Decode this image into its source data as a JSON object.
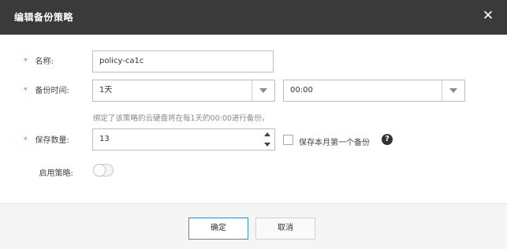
{
  "dialog": {
    "title": "编辑备份策略",
    "close_glyph": "✕"
  },
  "form": {
    "required_mark": "*",
    "name": {
      "label": "名称:",
      "value": "policy-ca1c"
    },
    "backup_time": {
      "label": "备份时间:",
      "frequency_value": "1天",
      "time_value": "00:00",
      "hint": "绑定了该策略的云硬盘将在每1天的00:00进行备份。"
    },
    "retention": {
      "label": "保存数量:",
      "value": "13",
      "keep_first_of_month_label": "保存本月第一个备份",
      "keep_first_of_month_checked": false,
      "help_glyph": "?"
    },
    "enable": {
      "label": "启用策略:",
      "enabled": false
    }
  },
  "footer": {
    "ok_label": "确定",
    "cancel_label": "取消"
  },
  "colors": {
    "header_bg": "#3a3a3a",
    "required": "#e34c3d",
    "primary_border": "#3e8cd6"
  }
}
